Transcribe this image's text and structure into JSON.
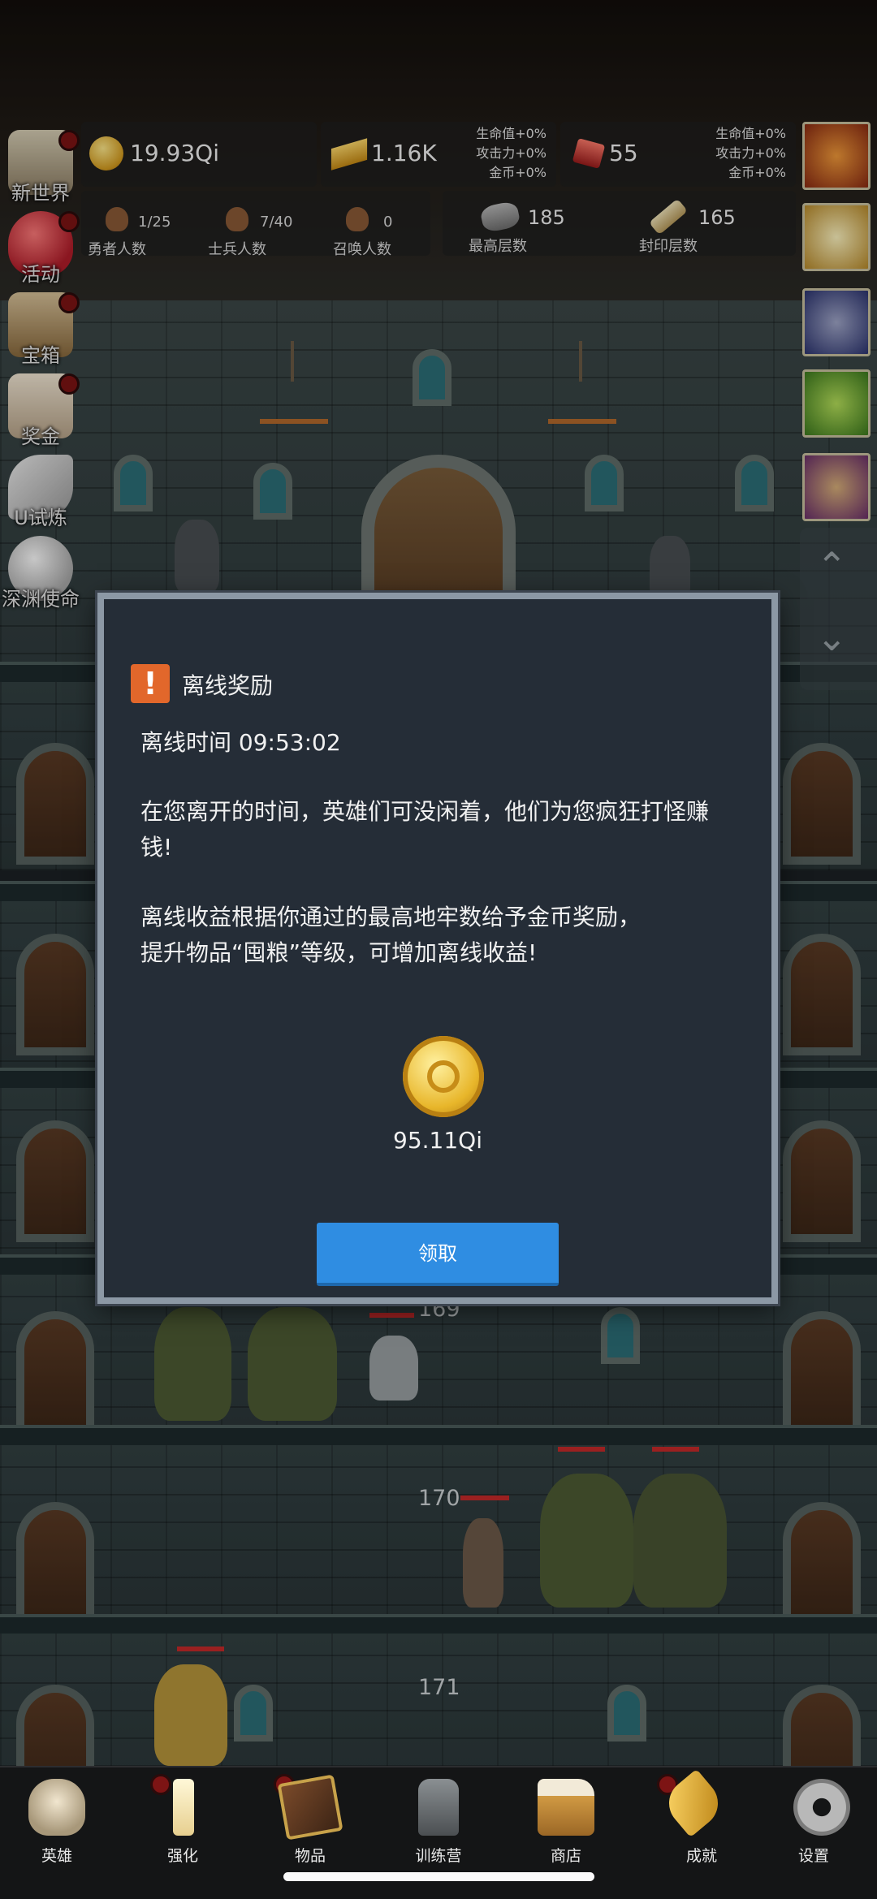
{
  "top_stats": {
    "coins": "19.93Qi",
    "gold": "1.16K",
    "gold_bonus": [
      "生命值+0%",
      "攻击力+0%",
      "金币+0%"
    ],
    "gems": "55",
    "gem_bonus": [
      "生命值+0%",
      "攻击力+0%",
      "金币+0%"
    ],
    "heroes_value": "1/25",
    "heroes_label": "勇者人数",
    "soldiers_value": "7/40",
    "soldiers_label": "士兵人数",
    "summons_value": "0",
    "summons_label": "召唤人数",
    "max_floor_value": "185",
    "max_floor_label": "最高层数",
    "sealed_floor_value": "165",
    "sealed_floor_label": "封印层数"
  },
  "left_menu": [
    {
      "label": "新世界"
    },
    {
      "label": "活动"
    },
    {
      "label": "宝箱"
    },
    {
      "label": "奖金"
    },
    {
      "label": "U试炼"
    },
    {
      "label": "深渊使命"
    }
  ],
  "dungeon": {
    "floors": [
      "169",
      "170",
      "171"
    ]
  },
  "modal": {
    "icon": "!",
    "title": "离线奖励",
    "offline_time": "离线时间 09:53:02",
    "line1": "在您离开的时间，英雄们可没闲着，他们为您疯狂打怪赚",
    "line2": "钱!",
    "line3": "离线收益根据你通过的最高地牢数给予金币奖励，",
    "line4": "提升物品“囤粮”等级，可增加离线收益!",
    "reward_amount": "95.11Qi",
    "claim_label": "领取"
  },
  "bottom_nav": [
    {
      "label": "英雄",
      "icon": "skull-icon"
    },
    {
      "label": "强化",
      "icon": "candle-icon"
    },
    {
      "label": "物品",
      "icon": "book-icon"
    },
    {
      "label": "训练营",
      "icon": "lantern-icon"
    },
    {
      "label": "商店",
      "icon": "mug-icon"
    },
    {
      "label": "成就",
      "icon": "key-icon"
    },
    {
      "label": "设置",
      "icon": "gear-icon"
    }
  ],
  "colors": {
    "modal_bg": "#252d37",
    "modal_border": "#8c98a5",
    "claim_button": "#2f8de2",
    "warning_icon": "#e2672b"
  }
}
